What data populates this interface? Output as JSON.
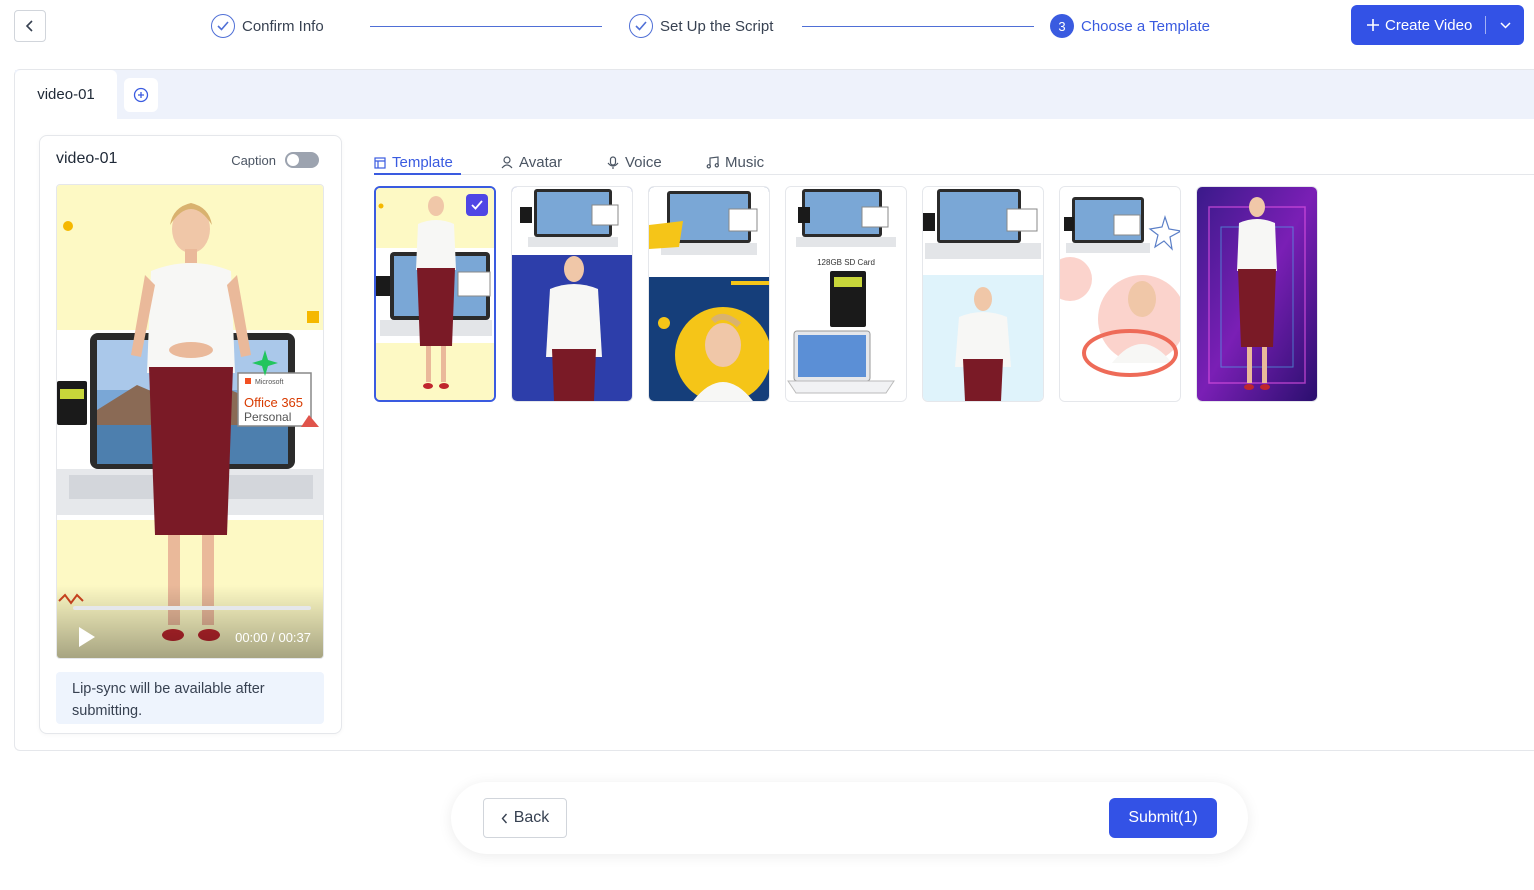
{
  "header": {
    "steps": [
      {
        "label": "Confirm Info",
        "state": "done"
      },
      {
        "label": "Set Up the Script",
        "state": "done"
      },
      {
        "label": "Choose a Template",
        "state": "active",
        "number": "3"
      }
    ],
    "create_label": "Create Video"
  },
  "tabs": {
    "video_tab": "video-01"
  },
  "preview": {
    "title": "video-01",
    "caption_label": "Caption",
    "caption_enabled": false,
    "time": "00:00 / 00:37",
    "progress": 0,
    "laptop_brand": "Microsoft",
    "product_name": "Office 365",
    "product_edition": "Personal",
    "note": "Lip-sync will be available after submitting."
  },
  "media_tabs": [
    "Template",
    "Avatar",
    "Voice",
    "Music"
  ],
  "templates": {
    "selected_index": 0,
    "count": 7,
    "sd_card_label": "128GB SD Card"
  },
  "footer": {
    "back_label": "Back",
    "submit_label": "Submit(1)"
  },
  "colors": {
    "accent": "#3352e6",
    "dress": "#7a1a26",
    "note_bg": "#eef4fd"
  }
}
